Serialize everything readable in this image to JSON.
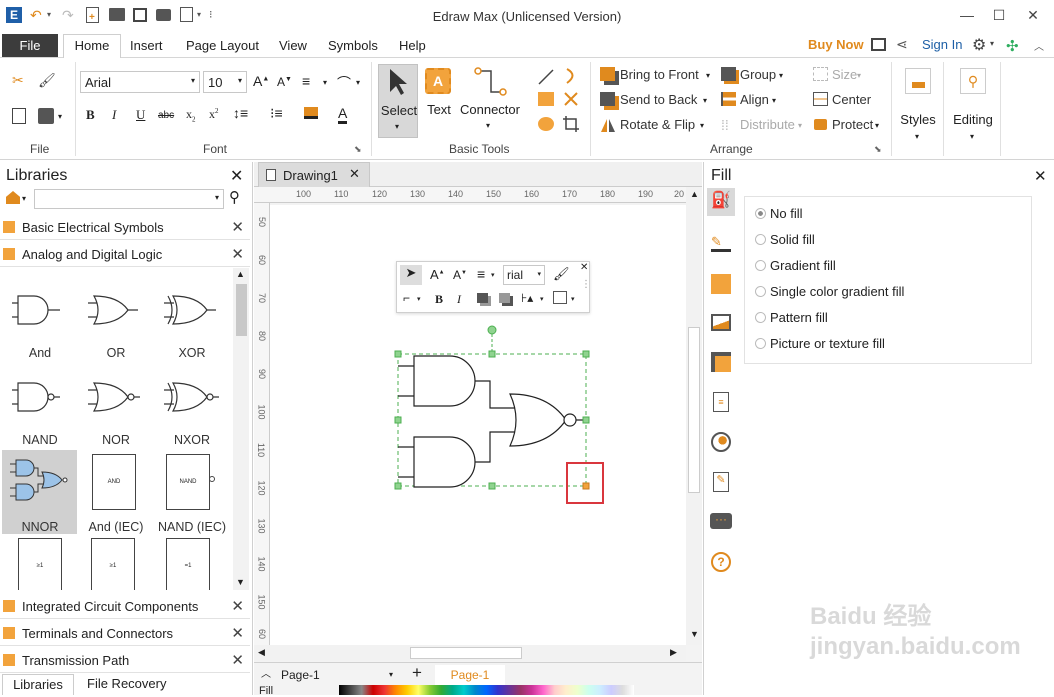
{
  "window": {
    "title": "Edraw Max (Unlicensed Version)",
    "controls": [
      "minimize-icon",
      "maximize-icon",
      "close-icon"
    ]
  },
  "menu": {
    "file": "File",
    "tabs": [
      "Home",
      "Insert",
      "Page Layout",
      "View",
      "Symbols",
      "Help"
    ],
    "buy_now": "Buy Now",
    "sign_in": "Sign In"
  },
  "ribbon": {
    "file_group": "File",
    "font_group": "Font",
    "font_name": "Arial",
    "font_size": "10",
    "basic_tools_group": "Basic Tools",
    "select": "Select",
    "text": "Text",
    "connector": "Connector",
    "arrange_group": "Arrange",
    "bring_to_front": "Bring to Front",
    "send_to_back": "Send to Back",
    "rotate_flip": "Rotate & Flip",
    "group": "Group",
    "align": "Align",
    "distribute": "Distribute",
    "size": "Size",
    "center": "Center",
    "protect": "Protect",
    "styles": "Styles",
    "editing": "Editing"
  },
  "libraries": {
    "title": "Libraries",
    "search_placeholder": "",
    "categories_top": [
      "Basic Electrical Symbols",
      "Analog and Digital Logic"
    ],
    "shapes": [
      {
        "label": "And"
      },
      {
        "label": "OR"
      },
      {
        "label": "XOR"
      },
      {
        "label": "NAND"
      },
      {
        "label": "NOR"
      },
      {
        "label": "NXOR"
      },
      {
        "label": "NNOR"
      },
      {
        "label": "And (IEC)"
      },
      {
        "label": "NAND (IEC)"
      }
    ],
    "iec_inner": [
      "AND",
      "NAND"
    ],
    "categories_bottom": [
      "Integrated Circuit Components",
      "Terminals and Connectors",
      "Transmission Path"
    ],
    "bottom_tabs": [
      "Libraries",
      "File Recovery"
    ]
  },
  "canvas": {
    "tab": "Drawing1",
    "ruler_top": [
      "100",
      "110",
      "120",
      "130",
      "140",
      "150",
      "160",
      "170",
      "180",
      "190",
      "20"
    ],
    "ruler_left": [
      "50",
      "60",
      "70",
      "80",
      "90",
      "100",
      "110",
      "120",
      "130",
      "140",
      "150",
      "60"
    ],
    "mini_toolbar_font": "rial"
  },
  "status": {
    "page_select": "Page-1",
    "page_tab": "Page-1",
    "fill_label": "Fill"
  },
  "fill_panel": {
    "title": "Fill",
    "options": [
      "No fill",
      "Solid fill",
      "Gradient fill",
      "Single color gradient fill",
      "Pattern fill",
      "Picture or texture fill"
    ],
    "selected": "No fill"
  },
  "colors": {
    "accent_orange": "#f2a33c",
    "file_tab": "#3c3c3c",
    "selection_green": "#4caf50",
    "highlight_red": "#d9363e"
  },
  "watermark": "Baidu 经验 jingyan.baidu.com"
}
